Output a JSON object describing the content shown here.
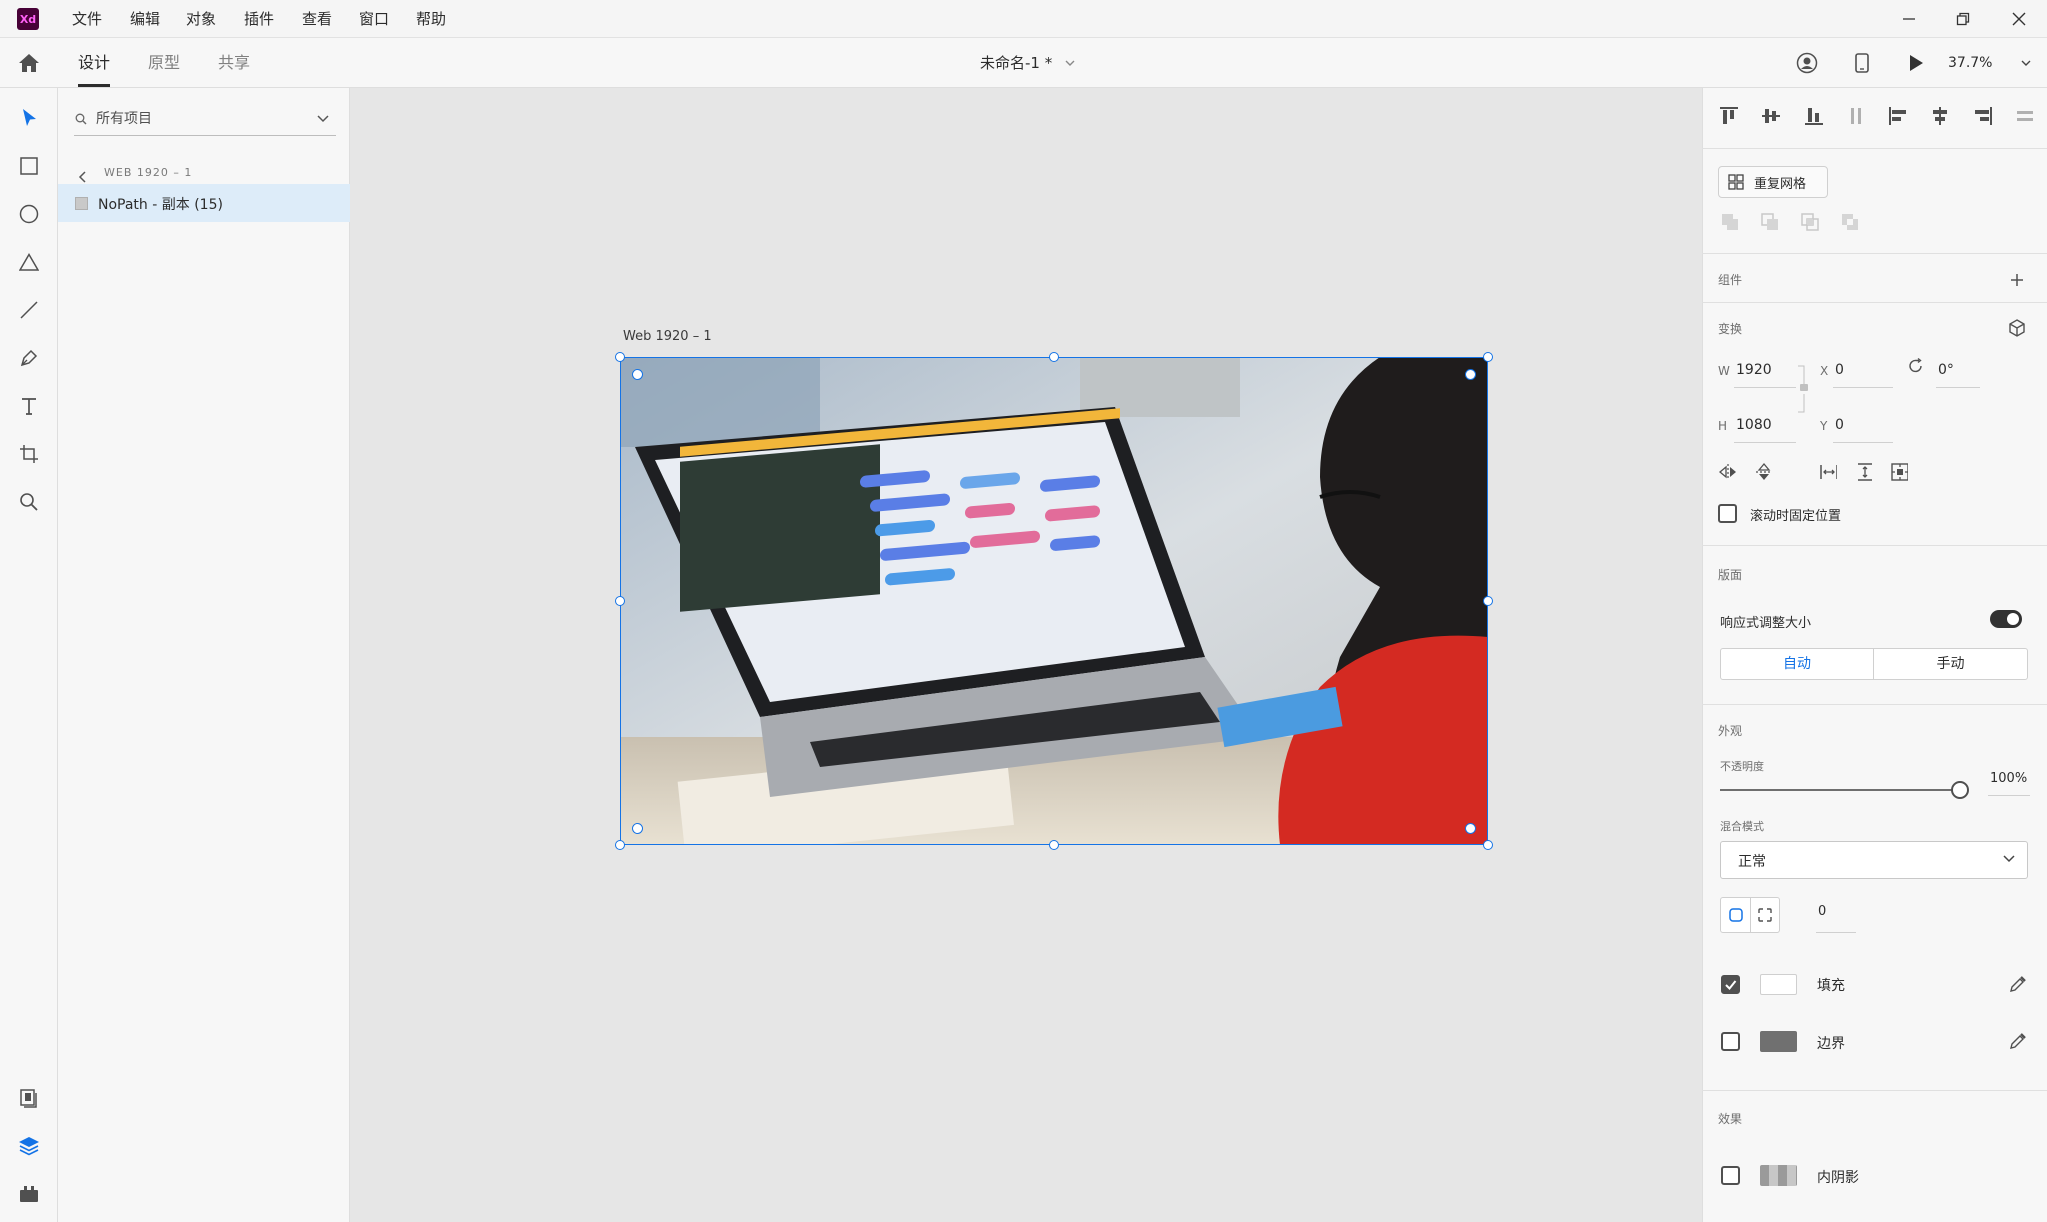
{
  "app": {
    "logo_text": "Xd",
    "brand_color": "#470137"
  },
  "menu": [
    "文件",
    "编辑",
    "对象",
    "插件",
    "查看",
    "窗口",
    "帮助"
  ],
  "tabs": {
    "design": "设计",
    "prototype": "原型",
    "share": "共享",
    "active": "design"
  },
  "document": {
    "title": "未命名-1 *",
    "zoom": "37.7%"
  },
  "layers": {
    "search_placeholder": "所有项目",
    "breadcrumb": "WEB 1920 – 1",
    "items": [
      {
        "label": "NoPath - 副本 (15)",
        "selected": true
      }
    ]
  },
  "canvas": {
    "artboard_label": "Web 1920 – 1",
    "selection_color": "#1473e6"
  },
  "right": {
    "repeat_grid": "重复网格",
    "components_title": "组件",
    "transform_title": "变换",
    "w_label": "W",
    "w_value": "1920",
    "h_label": "H",
    "h_value": "1080",
    "x_label": "X",
    "x_value": "0",
    "y_label": "Y",
    "y_value": "0",
    "rotation": "0°",
    "fix_position": "滚动时固定位置",
    "layout_title": "版面",
    "responsive": "响应式调整大小",
    "responsive_on": true,
    "auto": "自动",
    "manual": "手动",
    "appearance_title": "外观",
    "opacity_label": "不透明度",
    "opacity_value": "100%",
    "opacity_fraction": 1.0,
    "blend_label": "混合模式",
    "blend_value": "正常",
    "corner_value": "0",
    "fill_label": "填充",
    "fill_checked": true,
    "fill_color": "#ffffff",
    "border_label": "边界",
    "border_checked": false,
    "border_color": "#707070",
    "effects_title": "效果",
    "inner_shadow": "内阴影",
    "inner_shadow_checked": false
  }
}
